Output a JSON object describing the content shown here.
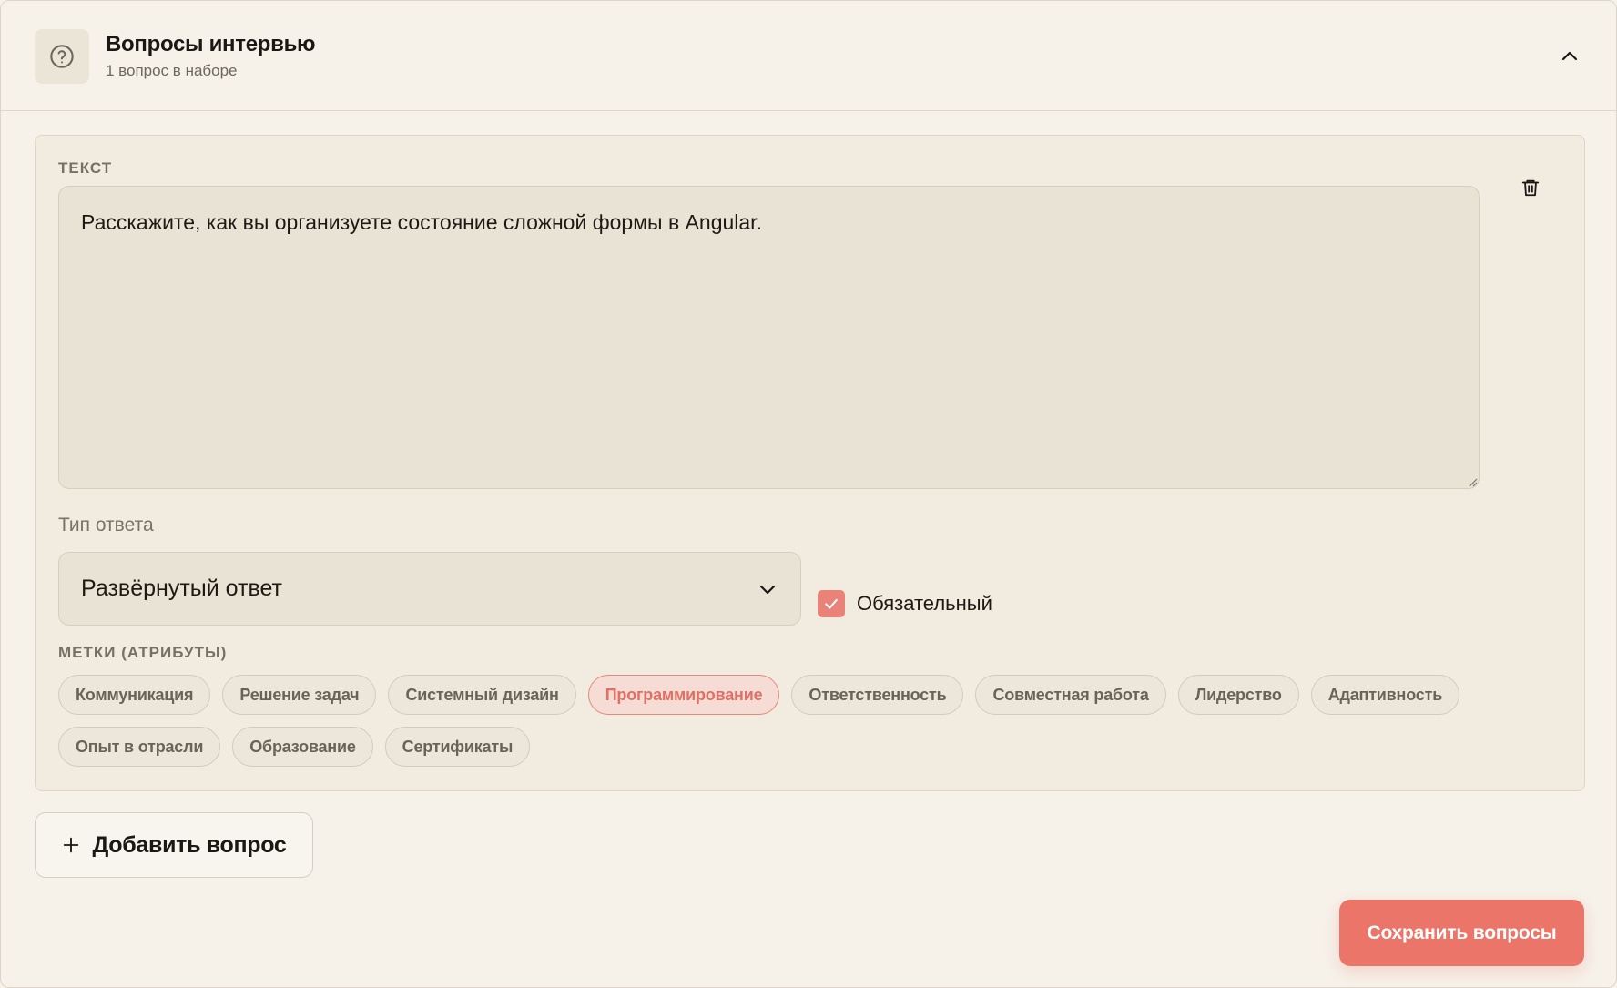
{
  "header": {
    "title": "Вопросы интервью",
    "subtitle": "1 вопрос в наборе",
    "icon": "help-circle-icon",
    "collapse_icon": "chevron-up-icon"
  },
  "question": {
    "text_label": "ТЕКСТ",
    "text_value": "Расскажите, как вы организуете состояние сложной формы в Angular.",
    "delete_icon": "trash-icon",
    "answer_type_label": "Тип ответа",
    "answer_type_value": "Развёрнутый ответ",
    "required_label": "Обязательный",
    "required_checked": true,
    "tags_label": "МЕТКИ (АТРИБУТЫ)",
    "tags": [
      {
        "label": "Коммуникация",
        "active": false
      },
      {
        "label": "Решение задач",
        "active": false
      },
      {
        "label": "Системный дизайн",
        "active": false
      },
      {
        "label": "Программирование",
        "active": true
      },
      {
        "label": "Ответственность",
        "active": false
      },
      {
        "label": "Совместная работа",
        "active": false
      },
      {
        "label": "Лидерство",
        "active": false
      },
      {
        "label": "Адаптивность",
        "active": false
      },
      {
        "label": "Опыт в отрасли",
        "active": false
      },
      {
        "label": "Образование",
        "active": false
      },
      {
        "label": "Сертификаты",
        "active": false
      }
    ]
  },
  "actions": {
    "add_label": "Добавить вопрос",
    "save_label": "Сохранить вопросы"
  },
  "colors": {
    "accent": "#ea7568",
    "background": "#f6f2ea",
    "card": "#f1ebe0"
  }
}
